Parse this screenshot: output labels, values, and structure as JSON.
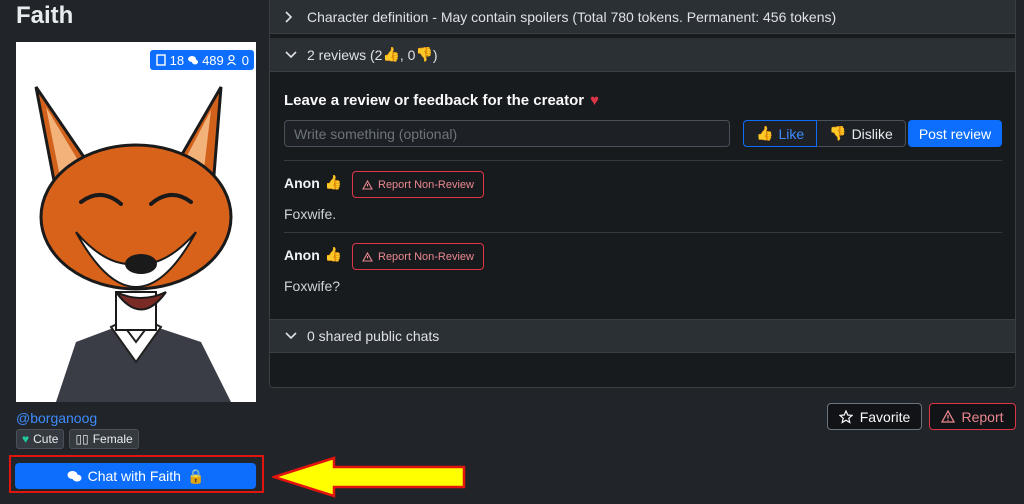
{
  "character": {
    "name": "Faith",
    "creator": "@borganoog",
    "tags": [
      {
        "icon": "heart-icon",
        "label": "Cute",
        "color": "#20c997"
      },
      {
        "icon": "placeholder-glyph-icon",
        "label": "Female",
        "glyph": "▯▯"
      }
    ],
    "stats": {
      "messages": "18",
      "chats": "489",
      "users": "0"
    },
    "chat_button": "Chat with Faith",
    "lock_glyph": "🔒"
  },
  "sections": {
    "definition": "Character definition - May contain spoilers (Total 780 tokens. Permanent: 456 tokens)",
    "reviews_prefix": "2 reviews (2 ",
    "reviews_mid": ", 0 ",
    "reviews_suffix": ")",
    "shared_chats": "0 shared public chats"
  },
  "review_form": {
    "heading": "Leave a review or feedback for the creator",
    "placeholder": "Write something (optional)",
    "like": "Like",
    "dislike": "Dislike",
    "post": "Post review"
  },
  "reviews": [
    {
      "author": "Anon",
      "report": "Report Non-Review",
      "text": "Foxwife."
    },
    {
      "author": "Anon",
      "report": "Report Non-Review",
      "text": "Foxwife?"
    }
  ],
  "actions": {
    "favorite": "Favorite",
    "report": "Report"
  },
  "colors": {
    "accent": "#0d6efd",
    "like_green": "#22bb55",
    "danger": "#dc3545",
    "highlight_red": "#e2140e",
    "arrow_yellow": "#ffff00"
  }
}
